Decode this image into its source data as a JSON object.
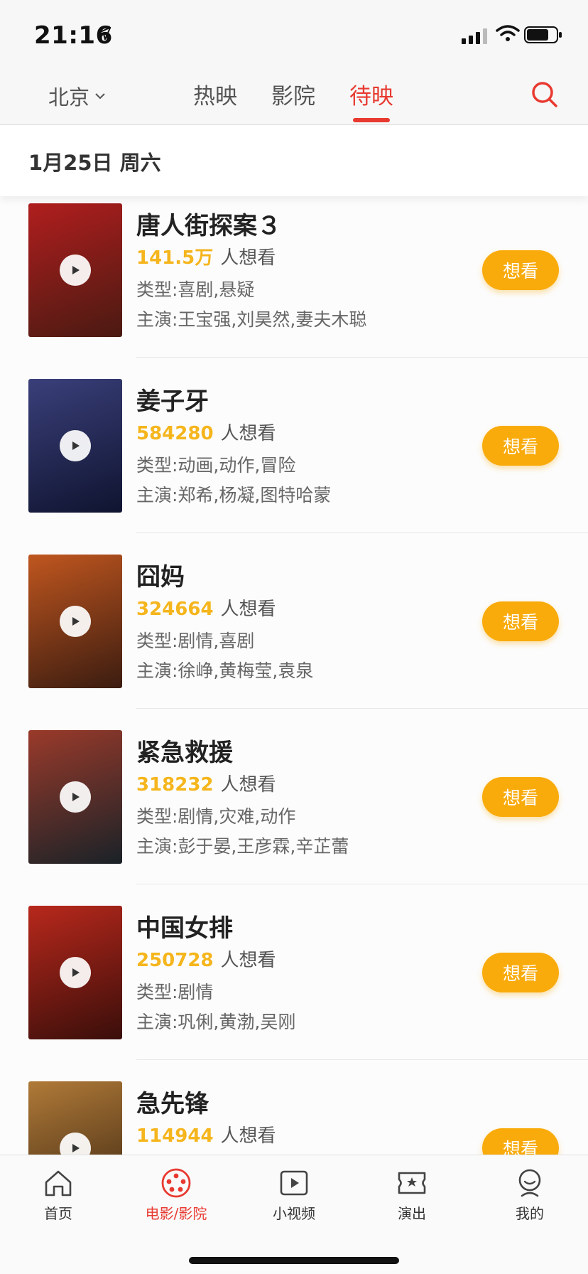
{
  "status_bar": {
    "time": "21:16"
  },
  "nav": {
    "city": "北京",
    "tabs": [
      {
        "label": "热映",
        "active": false
      },
      {
        "label": "影院",
        "active": false
      },
      {
        "label": "待映",
        "active": true
      }
    ]
  },
  "date_header": "1月25日 周六",
  "movies": [
    {
      "title": "唐人街探案３",
      "want_count": "141.5万",
      "want_suffix": "人想看",
      "genre": "类型:喜剧,悬疑",
      "cast": "主演:王宝强,刘昊然,妻夫木聪",
      "button": "想看",
      "poster_colors": [
        "#b01e1e",
        "#4a1a12"
      ]
    },
    {
      "title": "姜子牙",
      "want_count": "584280",
      "want_suffix": "人想看",
      "genre": "类型:动画,动作,冒险",
      "cast": "主演:郑希,杨凝,图特哈蒙",
      "button": "想看",
      "poster_colors": [
        "#3a3f7a",
        "#0f1430"
      ]
    },
    {
      "title": "囧妈",
      "want_count": "324664",
      "want_suffix": "人想看",
      "genre": "类型:剧情,喜剧",
      "cast": "主演:徐峥,黄梅莹,袁泉",
      "button": "想看",
      "poster_colors": [
        "#c0561f",
        "#3b1c10"
      ]
    },
    {
      "title": "紧急救援",
      "want_count": "318232",
      "want_suffix": "人想看",
      "genre": "类型:剧情,灾难,动作",
      "cast": "主演:彭于晏,王彦霖,辛芷蕾",
      "button": "想看",
      "poster_colors": [
        "#9a3a2a",
        "#1a2228"
      ]
    },
    {
      "title": "中国女排",
      "want_count": "250728",
      "want_suffix": "人想看",
      "genre": "类型:剧情",
      "cast": "主演:巩俐,黄渤,吴刚",
      "button": "想看",
      "poster_colors": [
        "#b8281c",
        "#3a0e0a"
      ]
    },
    {
      "title": "急先锋",
      "want_count": "114944",
      "want_suffix": "人想看",
      "genre": "",
      "cast": "",
      "button": "想看",
      "poster_colors": [
        "#b07a38",
        "#3a2410"
      ]
    }
  ],
  "tabbar": [
    {
      "label": "首页",
      "icon": "home-icon",
      "active": false
    },
    {
      "label": "电影/影院",
      "icon": "film-reel-icon",
      "active": true
    },
    {
      "label": "小视频",
      "icon": "video-play-icon",
      "active": false
    },
    {
      "label": "演出",
      "icon": "ticket-star-icon",
      "active": false
    },
    {
      "label": "我的",
      "icon": "profile-icon",
      "active": false
    }
  ],
  "colors": {
    "accent": "#e83a30",
    "want_number": "#f5b51c",
    "want_button": "#f9ab0c"
  }
}
